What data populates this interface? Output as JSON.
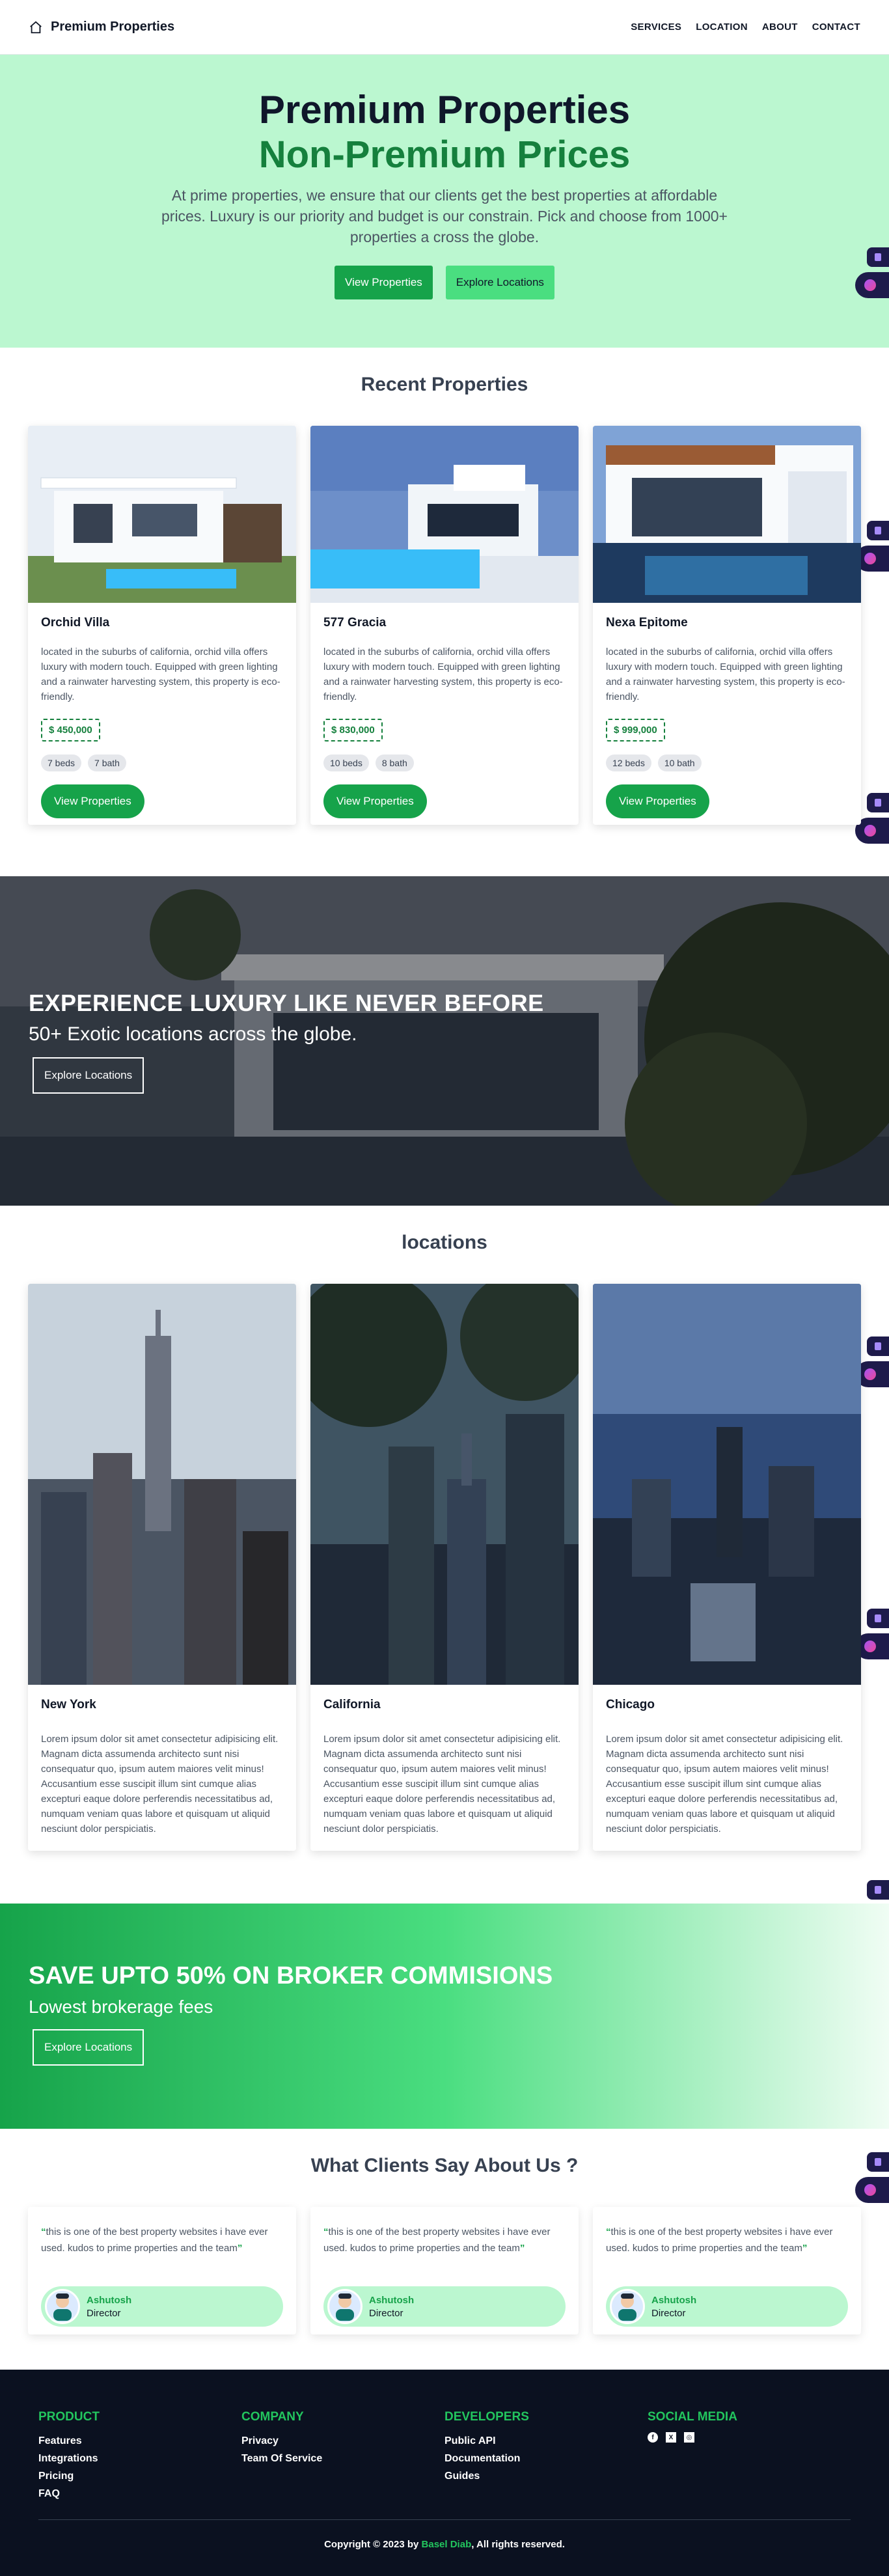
{
  "nav": {
    "brand": "Premium Properties",
    "links": [
      "SERVICES",
      "LOCATION",
      "ABOUT",
      "CONTACT"
    ]
  },
  "hero": {
    "title": "Premium Properties",
    "subtitle": "Non-Premium Prices",
    "description": "At prime properties, we ensure that our clients get the best properties at affordable prices. Luxury is our priority and budget is our constrain. Pick and choose from 1000+ properties a cross the globe.",
    "primary_button": "View Properties",
    "secondary_button": "Explore Locations"
  },
  "recent": {
    "title": "Recent Properties",
    "cards": [
      {
        "name": "Orchid Villa",
        "description": "located in the suburbs of california, orchid villa offers luxury with modern touch. Equipped with green lighting and a rainwater harvesting system, this property is eco-friendly.",
        "price": "$ 450,000",
        "beds": "7 beds",
        "baths": "7 bath",
        "button": "View Properties"
      },
      {
        "name": "577 Gracia",
        "description": "located in the suburbs of california, orchid villa offers luxury with modern touch. Equipped with green lighting and a rainwater harvesting system, this property is eco-friendly.",
        "price": "$ 830,000",
        "beds": "10 beds",
        "baths": "8 bath",
        "button": "View Properties"
      },
      {
        "name": "Nexa Epitome",
        "description": "located in the suburbs of california, orchid villa offers luxury with modern touch. Equipped with green lighting and a rainwater harvesting system, this property is eco-friendly.",
        "price": "$ 999,000",
        "beds": "12 beds",
        "baths": "10 bath",
        "button": "View Properties"
      }
    ]
  },
  "banner": {
    "heading": "EXPERIENCE LUXURY LIKE NEVER BEFORE",
    "subheading": "50+ Exotic locations across the globe.",
    "button": "Explore Locations"
  },
  "locations": {
    "title": "locations",
    "cards": [
      {
        "name": "New York",
        "description": "Lorem ipsum dolor sit amet consectetur adipisicing elit. Magnam dicta assumenda architecto sunt nisi consequatur quo, ipsum autem maiores velit minus! Accusantium esse suscipit illum sint cumque alias excepturi eaque dolore perferendis necessitatibus ad, numquam veniam quas labore et quisquam ut aliquid nesciunt dolor perspiciatis."
      },
      {
        "name": "California",
        "description": "Lorem ipsum dolor sit amet consectetur adipisicing elit. Magnam dicta assumenda architecto sunt nisi consequatur quo, ipsum autem maiores velit minus! Accusantium esse suscipit illum sint cumque alias excepturi eaque dolore perferendis necessitatibus ad, numquam veniam quas labore et quisquam ut aliquid nesciunt dolor perspiciatis."
      },
      {
        "name": "Chicago",
        "description": "Lorem ipsum dolor sit amet consectetur adipisicing elit. Magnam dicta assumenda architecto sunt nisi consequatur quo, ipsum autem maiores velit minus! Accusantium esse suscipit illum sint cumque alias excepturi eaque dolore perferendis necessitatibus ad, numquam veniam quas labore et quisquam ut aliquid nesciunt dolor perspiciatis."
      }
    ]
  },
  "promo": {
    "heading": "SAVE UPTO 50% ON BROKER COMMISIONS",
    "subheading": "Lowest brokerage fees",
    "button": "Explore Locations"
  },
  "testimonials": {
    "title": "What Clients Say About Us ?",
    "items": [
      {
        "quote": "this is one of the best property websites i have ever used. kudos to prime properties and the team",
        "name": "Ashutosh",
        "role": "Director"
      },
      {
        "quote": "this is one of the best property websites i have ever used. kudos to prime properties and the team",
        "name": "Ashutosh",
        "role": "Director"
      },
      {
        "quote": "this is one of the best property websites i have ever used. kudos to prime properties and the team",
        "name": "Ashutosh",
        "role": "Director"
      }
    ]
  },
  "footer": {
    "product": {
      "heading": "PRODUCT",
      "links": [
        "Features",
        "Integrations",
        "Pricing",
        "FAQ"
      ]
    },
    "company": {
      "heading": "COMPANY",
      "links": [
        "Privacy",
        "Team Of Service"
      ]
    },
    "developers": {
      "heading": "DEVELOPERS",
      "links": [
        "Public API",
        "Documentation",
        "Guides"
      ]
    },
    "social": {
      "heading": "SOCIAL MEDIA",
      "icons": [
        "facebook-icon",
        "x-icon",
        "instagram-icon"
      ]
    },
    "copyright_prefix": "Copyright © 2023 by",
    "author": "Basel Diab",
    "copyright_suffix": ", All rights reserved."
  },
  "colors": {
    "accent": "#16a34a",
    "hero_bg": "#bbf7d0",
    "footer_bg": "#0b1120"
  }
}
